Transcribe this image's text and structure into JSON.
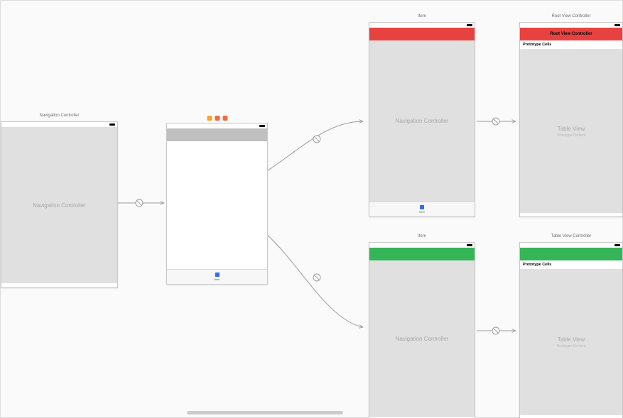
{
  "scenes": {
    "nav1": {
      "title": "Navigation Controller",
      "placeholder": "Navigation Controller"
    },
    "tabroot": {
      "tab_label": "Item"
    },
    "nav_red": {
      "title": "Item",
      "placeholder": "Navigation Controller",
      "bar_color": "#e74240"
    },
    "nav_green": {
      "title": "Item",
      "placeholder": "Navigation Controller",
      "bar_color": "#35b558"
    },
    "table_red": {
      "title": "Root View Controller",
      "nav_title": "Root View Controller",
      "section": "Prototype Cells",
      "placeholder": "Table View",
      "placeholder_sub": "Prototype Content",
      "bar_color": "#e74240"
    },
    "table_green": {
      "title": "Table View Controller",
      "section": "Prototype Cells",
      "placeholder": "Table View",
      "placeholder_sub": "Prototype Content",
      "bar_color": "#35b558"
    }
  },
  "icons": {
    "shield": "#f6a623",
    "exit": "#ee6a45",
    "first": "#ee6a45"
  }
}
